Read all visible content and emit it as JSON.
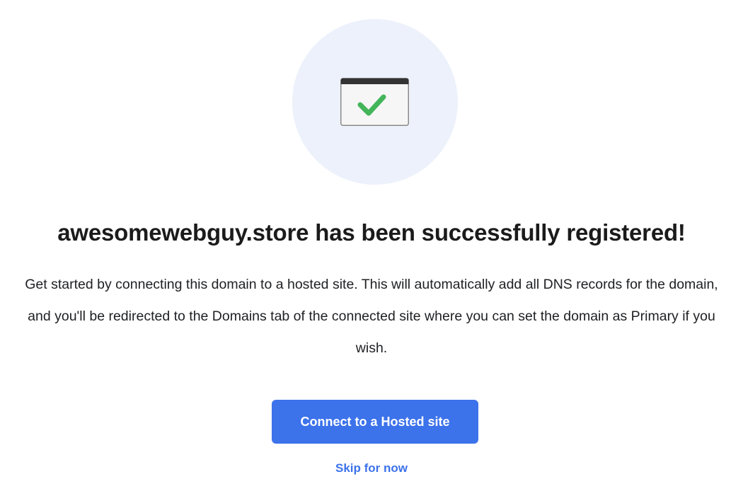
{
  "hero": {
    "icon": "browser-window-check-icon",
    "circle_color": "#ecf1fb",
    "check_color": "#43b55a"
  },
  "success": {
    "title": "awesomewebguy.store has been successfully registered!",
    "description": "Get started by connecting this domain to a hosted site. This will automatically add all DNS records for the domain, and you'll be redirected to the Domains tab of the connected site where you can set the domain as Primary if you wish."
  },
  "actions": {
    "connect_label": "Connect to a Hosted site",
    "skip_label": "Skip for now",
    "accent_color": "#3c72ea"
  }
}
